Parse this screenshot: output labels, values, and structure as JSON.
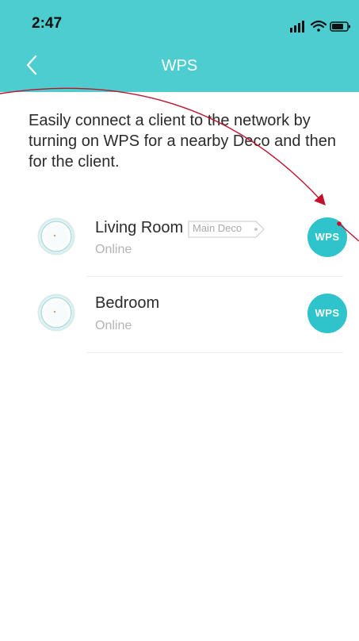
{
  "status_bar": {
    "time": "2:47"
  },
  "header": {
    "title": "WPS"
  },
  "intro_text": "Easily connect a client to the network by turning on WPS for a nearby Deco and then for the client.",
  "devices": [
    {
      "name": "Living Room",
      "badge": "Main Deco",
      "status": "Online",
      "button_label": "WPS"
    },
    {
      "name": "Bedroom",
      "status": "Online",
      "button_label": "WPS"
    }
  ],
  "colors": {
    "accent": "#4ecdd0",
    "button": "#2fc3cc",
    "annotation": "#c0102a"
  },
  "icons": [
    "back-icon",
    "signal-icon",
    "wifi-icon",
    "battery-icon",
    "deco-device-icon"
  ]
}
